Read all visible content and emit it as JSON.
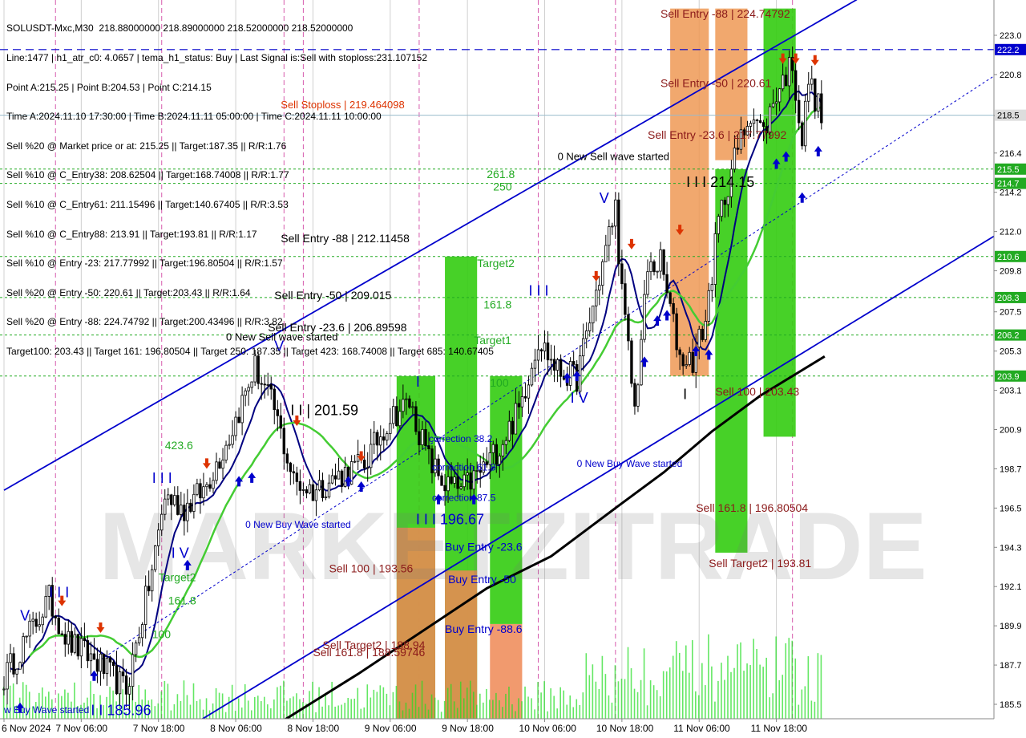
{
  "info_lines": [
    "SOLUSDT-Mxc,M30  218.88000000 218.89000000 218.52000000 218.52000000",
    "Line:1477 | h1_atr_c0: 4.0657 | tema_h1_status: Buy | Last Signal is:Sell with stoploss:231.107152",
    "Point A:215.25 | Point B:204.53 | Point C:214.15",
    "Time A:2024.11.10 17:30:00 | Time B:2024.11.11 05:00:00 | Time C:2024.11.11 10:00:00",
    "Sell %20 @ Market price or at: 215.25 || Target:187.35 || R/R:1.76",
    "Sell %10 @ C_Entry38: 208.62504 || Target:168.74008 || R/R:1.77",
    "Sell %10 @ C_Entry61: 211.15496 || Target:140.67405 || R/R:3.53",
    "Sell %10 @ C_Entry88: 213.91 || Target:193.81 || R/R:1.17",
    "Sell %10 @ Entry -23: 217.77992 || Target:196.80504 || R/R:1.57",
    "Sell %20 @ Entry -50: 220.61 || Target:203.43 || R/R:1.64",
    "Sell %20 @ Entry -88: 224.74792 || Target:200.43496 || R/R:3.82",
    "Target100: 203.43 || Target 161: 196.80504 || Target 250: 187.35 || Target 423: 168.74008 || Target 685: 140.67405"
  ],
  "chart_data": {
    "type": "candlestick",
    "symbol": "SOLUSDT-Mxc",
    "timeframe": "M30",
    "ohlc_last": [
      218.88,
      218.89,
      218.52,
      218.52
    ],
    "ylim": [
      184.5,
      224.5
    ],
    "y_ticks": [
      "223.0",
      "220.8",
      "218.5",
      "216.4",
      "214.2",
      "212.0",
      "209.8",
      "207.5",
      "205.3",
      "203.1",
      "200.9",
      "198.7",
      "196.5",
      "194.3",
      "192.1",
      "189.9",
      "187.7",
      "185.5"
    ],
    "y_tick_values": [
      223.0,
      220.8,
      218.5,
      216.4,
      214.2,
      212.0,
      209.8,
      207.5,
      205.3,
      203.1,
      200.9,
      198.7,
      196.5,
      194.3,
      192.1,
      189.9,
      187.7,
      185.5
    ],
    "x_labels": [
      "6 Nov 2024",
      "7 Nov 06:00",
      "7 Nov 18:00",
      "8 Nov 06:00",
      "8 Nov 18:00",
      "9 Nov 06:00",
      "9 Nov 18:00",
      "10 Nov 06:00",
      "10 Nov 18:00",
      "11 Nov 06:00",
      "11 Nov 18:00"
    ],
    "x_label_values": [
      0,
      24,
      48,
      72,
      96,
      120,
      144,
      168,
      192,
      216,
      240
    ],
    "price_tags": [
      {
        "label": "222.2",
        "value": 222.2,
        "color": "#0000cc"
      },
      {
        "label": "218.5",
        "value": 218.52,
        "color": "#dddddd"
      },
      {
        "label": "215.5",
        "value": 215.5,
        "color": "#22aa22"
      },
      {
        "label": "214.7",
        "value": 214.7,
        "color": "#22aa22"
      },
      {
        "label": "210.6",
        "value": 210.6,
        "color": "#22aa22"
      },
      {
        "label": "208.3",
        "value": 208.3,
        "color": "#22aa22"
      },
      {
        "label": "206.2",
        "value": 206.2,
        "color": "#22aa22"
      },
      {
        "label": "203.9",
        "value": 203.9,
        "color": "#22aa22"
      }
    ],
    "annotations": [
      {
        "text": "Sell Entry -88 | 224.74792",
        "t": 204,
        "y": 224.0,
        "color": "#8b1a1a",
        "size": 14
      },
      {
        "text": "Sell Entry -50 | 220.61",
        "t": 204,
        "y": 220.1,
        "color": "#8b1a1a",
        "size": 14
      },
      {
        "text": "Sell Entry -23.6 | 217.77992",
        "t": 200,
        "y": 217.2,
        "color": "#8b1a1a",
        "size": 14
      },
      {
        "text": "Sell Stoploss | 219.464098",
        "t": 86,
        "y": 218.9,
        "color": "#dd3300",
        "size": 13
      },
      {
        "text": "0 New Sell wave started",
        "t": 172,
        "y": 216.0,
        "color": "#000000",
        "size": 13
      },
      {
        "text": "I I I 214.15",
        "t": 212,
        "y": 214.5,
        "color": "#000000",
        "size": 18
      },
      {
        "text": "261.8",
        "t": 150,
        "y": 215.0,
        "color": "#22aa22",
        "size": 14
      },
      {
        "text": "250",
        "t": 152,
        "y": 214.3,
        "color": "#22aa22",
        "size": 14
      },
      {
        "text": "Sell Entry -88 | 212.11458",
        "t": 86,
        "y": 211.4,
        "color": "#000000",
        "size": 14
      },
      {
        "text": "Target2",
        "t": 147,
        "y": 210.0,
        "color": "#22aa22",
        "size": 14
      },
      {
        "text": "Sell Entry -50 | 209.015",
        "t": 84,
        "y": 208.2,
        "color": "#000000",
        "size": 14
      },
      {
        "text": "161.8",
        "t": 149,
        "y": 207.7,
        "color": "#22aa22",
        "size": 14
      },
      {
        "text": "I I I",
        "t": 163,
        "y": 208.4,
        "color": "#0000cc",
        "size": 18
      },
      {
        "text": "Sell Entry -23.6 | 206.89598",
        "t": 82,
        "y": 206.4,
        "color": "#000000",
        "size": 14
      },
      {
        "text": "0 New Sell wave started",
        "t": 69,
        "y": 205.9,
        "color": "#000000",
        "size": 13
      },
      {
        "text": "Target1",
        "t": 146,
        "y": 205.7,
        "color": "#22aa22",
        "size": 14
      },
      {
        "text": "V",
        "t": 185,
        "y": 213.6,
        "color": "#0000cc",
        "size": 18
      },
      {
        "text": "V",
        "t": 84,
        "y": 205.3,
        "color": "#0000cc",
        "size": 18
      },
      {
        "text": "100",
        "t": 151,
        "y": 203.3,
        "color": "#22aa22",
        "size": 14
      },
      {
        "text": "I",
        "t": 128,
        "y": 203.3,
        "color": "#0000cc",
        "size": 18
      },
      {
        "text": "I V",
        "t": 176,
        "y": 202.4,
        "color": "#0000cc",
        "size": 18
      },
      {
        "text": "I",
        "t": 211,
        "y": 202.6,
        "color": "#000000",
        "size": 18
      },
      {
        "text": "Sell 100 | 203.43",
        "t": 221,
        "y": 202.8,
        "color": "#8b1a1a",
        "size": 14
      },
      {
        "text": "I I | 201.59",
        "t": 89,
        "y": 201.7,
        "color": "#000000",
        "size": 18
      },
      {
        "text": "correction 38.2",
        "t": 132,
        "y": 200.2,
        "color": "#0000cc",
        "size": 12
      },
      {
        "text": "correction 61.8",
        "t": 133,
        "y": 198.6,
        "color": "#0000cc",
        "size": 12
      },
      {
        "text": "0 New Buy Wave started",
        "t": 178,
        "y": 198.8,
        "color": "#0000cc",
        "size": 12
      },
      {
        "text": "correction 87.5",
        "t": 133,
        "y": 196.9,
        "color": "#0000cc",
        "size": 12
      },
      {
        "text": "423.6",
        "t": 50,
        "y": 199.8,
        "color": "#22aa22",
        "size": 14
      },
      {
        "text": "I I I",
        "t": 46,
        "y": 197.9,
        "color": "#0000cc",
        "size": 18
      },
      {
        "text": "Sell 161.8 | 196.80504",
        "t": 215,
        "y": 196.3,
        "color": "#8b1a1a",
        "size": 14
      },
      {
        "text": "I I I 196.67",
        "t": 128,
        "y": 195.6,
        "color": "#0000cc",
        "size": 18
      },
      {
        "text": "0 New Buy Wave started",
        "t": 75,
        "y": 195.4,
        "color": "#0000cc",
        "size": 12
      },
      {
        "text": "Buy Entry -23.6",
        "t": 137,
        "y": 194.1,
        "color": "#0000cc",
        "size": 14
      },
      {
        "text": "I V",
        "t": 52,
        "y": 193.7,
        "color": "#0000cc",
        "size": 18
      },
      {
        "text": "Sell Target2 | 193.81",
        "t": 219,
        "y": 193.2,
        "color": "#8b1a1a",
        "size": 14
      },
      {
        "text": "Sell 100 | 193.56",
        "t": 101,
        "y": 192.9,
        "color": "#8b1a1a",
        "size": 14
      },
      {
        "text": "Target2",
        "t": 48,
        "y": 192.4,
        "color": "#22aa22",
        "size": 14
      },
      {
        "text": "Buy Entry -50",
        "t": 138,
        "y": 192.3,
        "color": "#0000cc",
        "size": 14
      },
      {
        "text": "I I I",
        "t": 14,
        "y": 191.5,
        "color": "#0000cc",
        "size": 18
      },
      {
        "text": "161.8",
        "t": 51,
        "y": 191.1,
        "color": "#22aa22",
        "size": 14
      },
      {
        "text": "V",
        "t": 5,
        "y": 190.2,
        "color": "#0000cc",
        "size": 18
      },
      {
        "text": "Buy Entry -88.6",
        "t": 137,
        "y": 189.5,
        "color": "#0000cc",
        "size": 14
      },
      {
        "text": "100",
        "t": 46,
        "y": 189.2,
        "color": "#22aa22",
        "size": 14
      },
      {
        "text": "Sell Target2 | 188.94",
        "t": 99,
        "y": 188.6,
        "color": "#8b1a1a",
        "size": 14
      },
      {
        "text": "Sell 161.8 | 188.59746",
        "t": 96,
        "y": 188.2,
        "color": "#8b1a1a",
        "size": 14
      },
      {
        "text": "w Buy Wave started",
        "t": 0,
        "y": 185.0,
        "color": "#0000cc",
        "size": 12
      },
      {
        "text": "I I 185.96",
        "t": 27,
        "y": 184.9,
        "color": "#0000cc",
        "size": 18
      }
    ],
    "watermark": "MARKETZITRADE"
  }
}
